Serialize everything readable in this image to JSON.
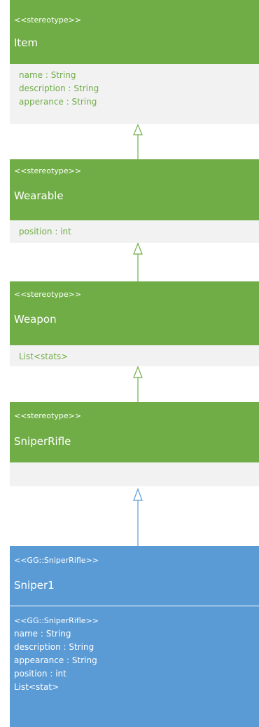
{
  "colors": {
    "green_header": "#70ad47",
    "green_body": "#f2f2f2",
    "blue": "#5b9bd5"
  },
  "classes": [
    {
      "stereotype": "<<stereotype>>",
      "name": "Item",
      "attributes": [
        "name : String",
        "description : String",
        "apperance : String"
      ]
    },
    {
      "stereotype": "<<stereotype>>",
      "name": "Wearable",
      "attributes": [
        "position : int"
      ]
    },
    {
      "stereotype": "<<stereotype>>",
      "name": "Weapon",
      "attributes": [
        "List<stats>"
      ]
    },
    {
      "stereotype": "<<stereotype>>",
      "name": "SniperRifle",
      "attributes": []
    },
    {
      "stereotype": "<<GG::SniperRifle>>",
      "name": "Sniper1",
      "attributes": [
        "<<GG::SniperRifle>>",
        "name : String",
        "description : String",
        "appearance : String",
        "position : int",
        "List<stat>"
      ]
    }
  ],
  "relations": [
    {
      "type": "generalization",
      "from": "Wearable",
      "to": "Item"
    },
    {
      "type": "generalization",
      "from": "Weapon",
      "to": "Wearable"
    },
    {
      "type": "generalization",
      "from": "SniperRifle",
      "to": "Weapon"
    },
    {
      "type": "realization",
      "from": "Sniper1",
      "to": "SniperRifle"
    }
  ]
}
